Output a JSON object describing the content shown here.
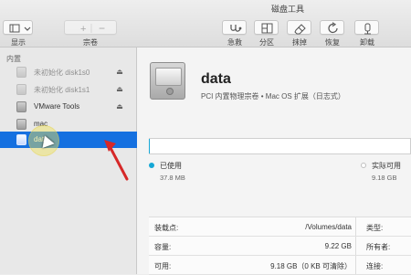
{
  "toolbar": {
    "window_title": "磁盘工具",
    "display_label": "显示",
    "volume_label": "宗卷",
    "actions": [
      {
        "label": "急救",
        "icon": "stethoscope-icon"
      },
      {
        "label": "分区",
        "icon": "partition-icon"
      },
      {
        "label": "抹掉",
        "icon": "erase-icon"
      },
      {
        "label": "恢复",
        "icon": "restore-icon"
      },
      {
        "label": "卸载",
        "icon": "unmount-icon"
      }
    ]
  },
  "sidebar": {
    "section": "内置",
    "items": [
      {
        "label": "未初始化 disk1s0",
        "state": "dimmed"
      },
      {
        "label": "未初始化 disk1s1",
        "state": "dimmed"
      },
      {
        "label": "VMware Tools",
        "state": "normal"
      },
      {
        "label": "mac",
        "state": "normal"
      },
      {
        "label": "data",
        "state": "selected"
      }
    ]
  },
  "volume": {
    "name": "data",
    "description": "PCI 内置物理宗卷 • Mac OS 扩展（日志式）",
    "usage_fraction": 0.004,
    "used_label": "已使用",
    "used_value": "37.8 MB",
    "available_label": "实际可用",
    "available_value": "9.18 GB"
  },
  "info": {
    "rows": [
      {
        "key": "装载点:",
        "value": "/Volumes/data",
        "side": "类型:"
      },
      {
        "key": "容量:",
        "value": "9.22 GB",
        "side": "所有者:"
      },
      {
        "key": "可用:",
        "value": "9.18 GB（0 KB 可清除）",
        "side": "连接:"
      }
    ]
  },
  "colors": {
    "selection": "#1570e0",
    "used": "#15a7d5",
    "available": "#ffffff",
    "annotation_arrow": "#d62828"
  }
}
